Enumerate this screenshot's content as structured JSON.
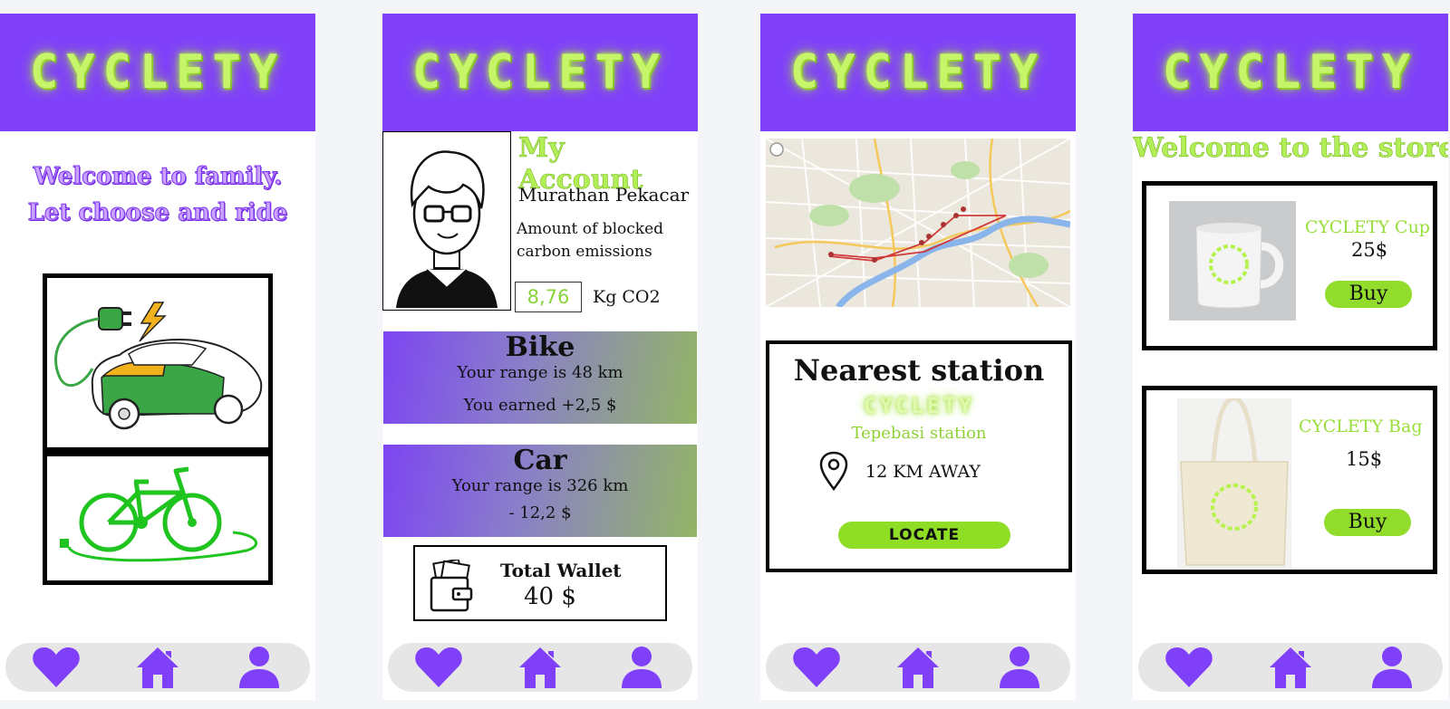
{
  "brand": {
    "logo_text": "CYCLETY",
    "accent": "#8040fa",
    "highlight": "#b2ee55"
  },
  "nav_items": [
    "heart-icon",
    "home-icon",
    "user-icon"
  ],
  "screen_welcome": {
    "title": "Welcome to family. Let choose and ride",
    "options": [
      "electric-car",
      "electric-bike"
    ]
  },
  "screen_account": {
    "title": "My Account",
    "user_name": "Murathan Pekacar",
    "carbon_label": "Amount of  blocked carbon emissions",
    "carbon_value": "8,76",
    "carbon_unit": "Kg CO2",
    "bike": {
      "title": "Bike",
      "range": "Your range is 48 km",
      "amount": "You earned +2,5 $"
    },
    "car": {
      "title": "Car",
      "range": "Your range is 326 km",
      "amount": "- 12,2 $"
    },
    "wallet": {
      "title": "Total Wallet",
      "amount": "40 $"
    }
  },
  "screen_station": {
    "title": "Nearest station",
    "logo": "CYCLETY",
    "station_name": "Tepebasi station",
    "distance": "12 KM AWAY",
    "locate_label": "LOCATE"
  },
  "screen_store": {
    "title": "Welcome to the store",
    "products": [
      {
        "name": "CYCLETY Cup",
        "price": "25$",
        "buy_label": "Buy"
      },
      {
        "name": "CYCLETY Bag",
        "price": "15$",
        "buy_label": "Buy"
      }
    ]
  }
}
